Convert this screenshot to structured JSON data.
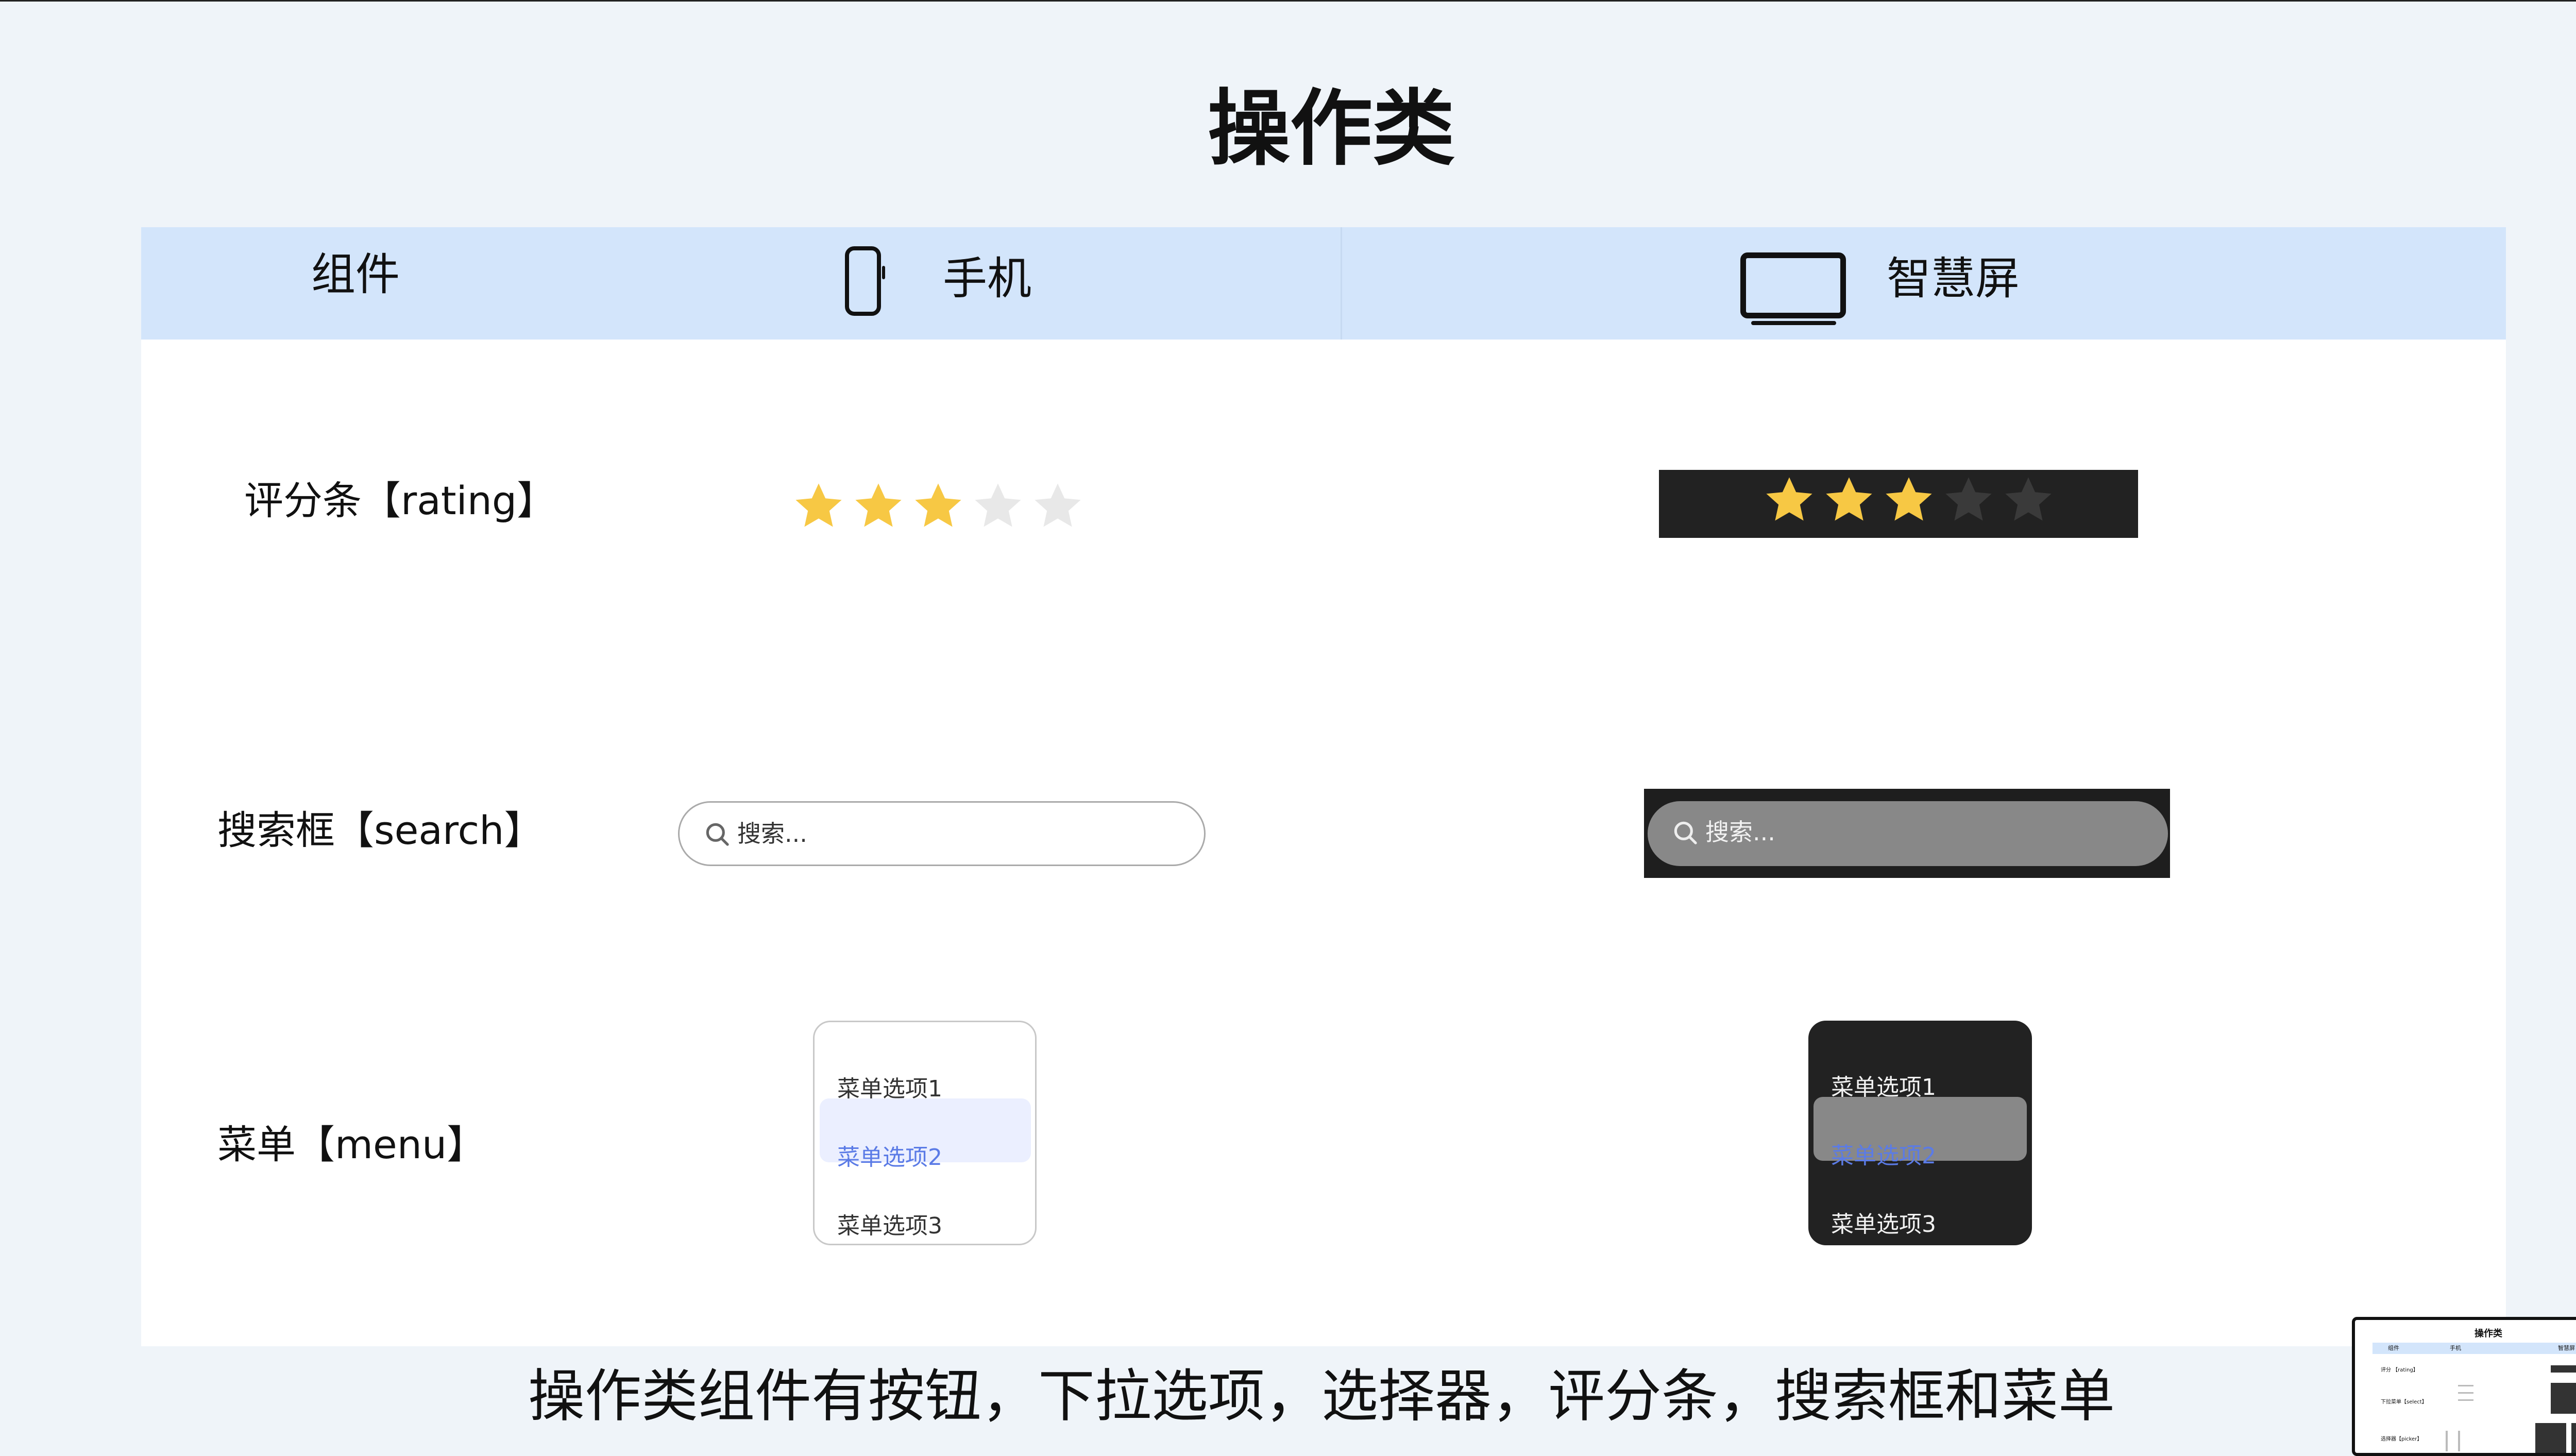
{
  "slide": {
    "title": "操作类",
    "caption": "操作类组件有按钮，下拉选项，选择器，评分条，搜索框和菜单"
  },
  "header": {
    "col_component": "组件",
    "col_phone": "手机",
    "col_phone_icon": "phone-icon",
    "col_tv": "智慧屏",
    "col_tv_icon": "tv-icon"
  },
  "rows": {
    "rating": {
      "label": "评分条【rating】",
      "value": 3,
      "max": 5,
      "star_color": "#f7c844",
      "phone_empty_color": "#e8e8e8",
      "tv_empty_color": "#3a3a3a"
    },
    "search": {
      "label": "搜索框【search】",
      "placeholder": "搜索..."
    },
    "menu": {
      "label": "菜单【menu】",
      "items": [
        "菜单选项1",
        "菜单选项2",
        "菜单选项3"
      ],
      "selected_index": 1,
      "selected_color": "#5b7be6"
    }
  },
  "thumbnail": {
    "title": "操作类",
    "col_component": "组件",
    "col_phone": "手机",
    "col_tv": "智慧屏",
    "row_rating": "评分 【rating】",
    "row_search": "下拉菜单【select】",
    "row_menu": "选择器【picker】"
  }
}
